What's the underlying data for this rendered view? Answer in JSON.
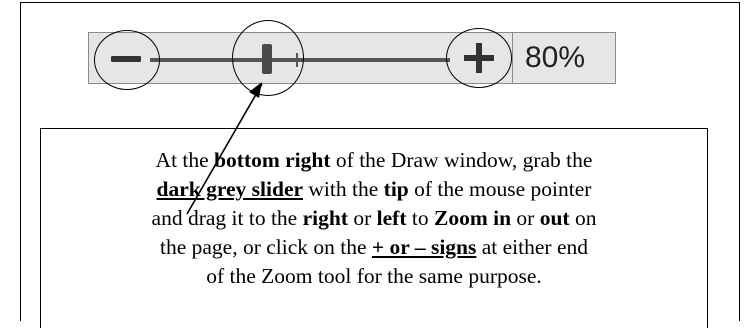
{
  "zoom": {
    "value_text": "80%",
    "slider_level_percent": 80,
    "minus_symbol": "−",
    "plus_symbol": "+"
  },
  "callout": {
    "line1": {
      "t1": "At the ",
      "b1": "bottom right",
      "t2": " of the Draw window, grab the"
    },
    "line2": {
      "u1": "dark grey slider",
      "t1": " with the ",
      "b1": "tip",
      "t2": " of the mouse pointer"
    },
    "line3": {
      "t1": "and drag it to the ",
      "b1": "right",
      "t2": " or ",
      "b2": "left",
      "t3": " to ",
      "b3": "Zoom in",
      "t4": " or ",
      "b4": "out",
      "t5": " on"
    },
    "line4": {
      "t1": "the page, or click on the ",
      "u1": "+ or – signs",
      "t2": " at either end"
    },
    "line5": {
      "t1": "of the Zoom tool for the same purpose."
    }
  },
  "colors": {
    "bar_background": "#e6e6e6",
    "slider_thumb": "#4a4a4a",
    "track": "#555555"
  }
}
